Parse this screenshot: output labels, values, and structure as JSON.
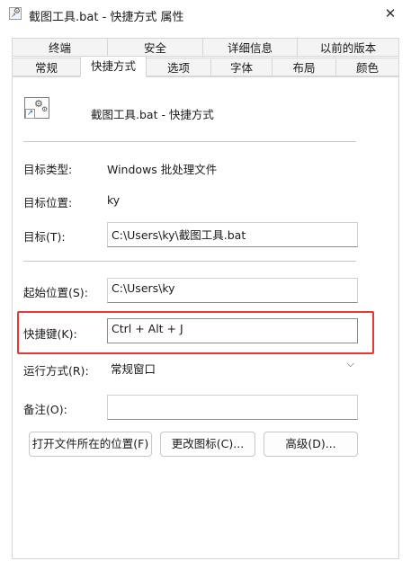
{
  "window": {
    "title": "截图工具.bat - 快捷方式 属性",
    "close_glyph": "✕"
  },
  "tabs_row1": [
    "终端",
    "安全",
    "详细信息",
    "以前的版本"
  ],
  "tabs_row2": [
    "常规",
    "快捷方式",
    "选项",
    "字体",
    "布局",
    "颜色"
  ],
  "shortcut": {
    "name": "截图工具.bat - 快捷方式",
    "icon": "batch-file-shortcut-icon"
  },
  "fields": {
    "target_type_label": "目标类型:",
    "target_type_value": "Windows 批处理文件",
    "target_location_label": "目标位置:",
    "target_location_value": "ky",
    "target_label": "目标(T):",
    "target_value": "C:\\Users\\ky\\截图工具.bat",
    "start_in_label": "起始位置(S):",
    "start_in_value": "C:\\Users\\ky",
    "hotkey_label": "快捷键(K):",
    "hotkey_value": "Ctrl + Alt + J",
    "run_label": "运行方式(R):",
    "run_value": "常规窗口",
    "comment_label": "备注(O):",
    "comment_value": ""
  },
  "buttons": {
    "open_location": "打开文件所在的位置(F)",
    "change_icon": "更改图标(C)...",
    "advanced": "高级(D)..."
  },
  "colors": {
    "highlight": "#e53935",
    "accent": "#1a73c9"
  }
}
